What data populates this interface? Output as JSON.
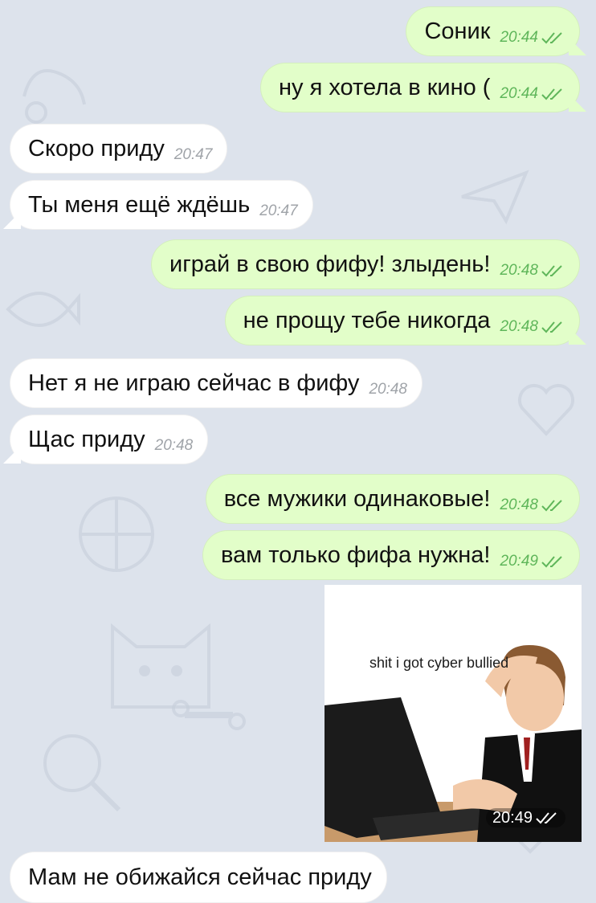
{
  "colors": {
    "background": "#dde3ec",
    "outgoing_bubble": "#e2fec9",
    "incoming_bubble": "#ffffff",
    "outgoing_time": "#5fb65a",
    "incoming_time": "#a0a4a9"
  },
  "messages": [
    {
      "direction": "outgoing",
      "text": "Соник",
      "time": "20:44",
      "status_icon": "double-check-icon"
    },
    {
      "direction": "outgoing",
      "text": "ну я хотела в кино (",
      "time": "20:44",
      "status_icon": "double-check-icon"
    },
    {
      "direction": "incoming",
      "text": "Скоро приду",
      "time": "20:47"
    },
    {
      "direction": "incoming",
      "text": "Ты меня ещё ждёшь",
      "time": "20:47"
    },
    {
      "direction": "outgoing",
      "text": "играй в свою фифу! злыдень!",
      "time": "20:48",
      "status_icon": "double-check-icon"
    },
    {
      "direction": "outgoing",
      "text": "не прощу тебе никогда",
      "time": "20:48",
      "status_icon": "double-check-icon"
    },
    {
      "direction": "incoming",
      "text": "Нет я не играю сейчас в фифу",
      "time": "20:48"
    },
    {
      "direction": "incoming",
      "text": "Щас приду",
      "time": "20:48"
    },
    {
      "direction": "outgoing",
      "text": "все мужики одинаковые!",
      "time": "20:48",
      "status_icon": "double-check-icon"
    },
    {
      "direction": "outgoing",
      "text": "вам только фифа нужна!",
      "time": "20:49",
      "status_icon": "double-check-icon"
    }
  ],
  "photo_message": {
    "direction": "outgoing",
    "caption": "shit i got cyber bullied",
    "time": "20:49",
    "status_icon": "double-check-icon"
  },
  "last_message": {
    "direction": "incoming",
    "text": "Мам не обижайся сейчас приду"
  }
}
